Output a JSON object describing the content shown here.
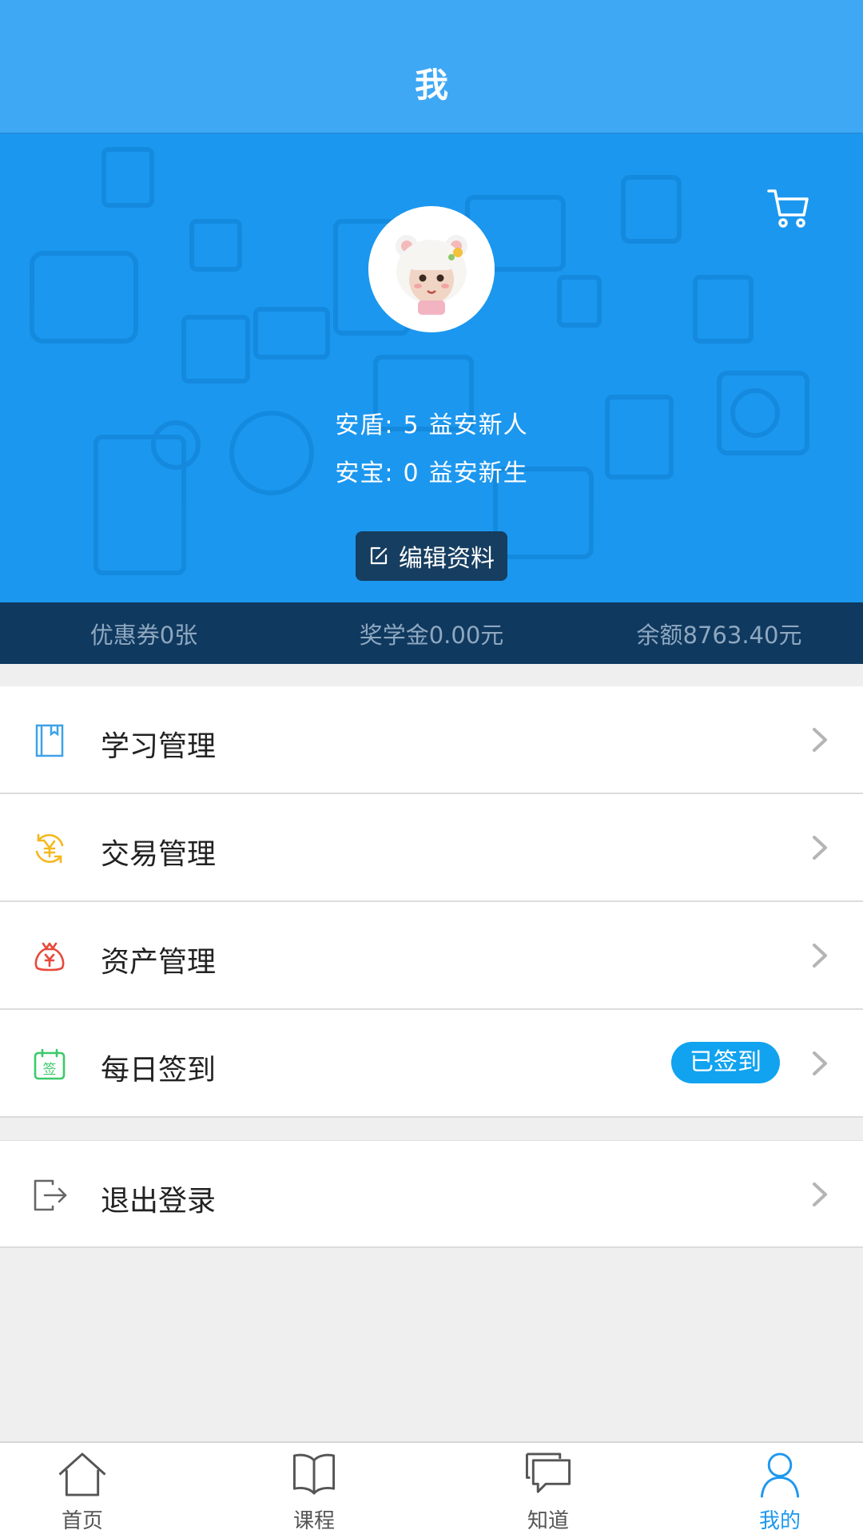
{
  "header": {
    "title": "我"
  },
  "profile": {
    "line1": {
      "label": "安盾:",
      "value": "5",
      "rank": "益安新人"
    },
    "line2": {
      "label": "安宝:",
      "value": "0",
      "rank": "益安新生"
    },
    "edit_label": "编辑资料"
  },
  "wallet": {
    "coupons": "优惠券0张",
    "scholarship": "奖学金0.00元",
    "balance": "余额8763.40元"
  },
  "menu": [
    {
      "label": "学习管理",
      "icon": "book-icon",
      "color": "#3da2e8"
    },
    {
      "label": "交易管理",
      "icon": "yuan-exchange-icon",
      "color": "#f3b81f"
    },
    {
      "label": "资产管理",
      "icon": "money-bag-icon",
      "color": "#e8493b"
    },
    {
      "label": "每日签到",
      "icon": "calendar-sign-icon",
      "color": "#3cc96a",
      "badge": "已签到"
    }
  ],
  "logout": {
    "label": "退出登录",
    "icon": "logout-icon"
  },
  "tabs": [
    {
      "label": "首页",
      "icon": "home-icon"
    },
    {
      "label": "课程",
      "icon": "book-open-icon"
    },
    {
      "label": "知道",
      "icon": "chat-icon"
    },
    {
      "label": "我的",
      "icon": "user-icon",
      "active": true
    }
  ],
  "colors": {
    "header_bg": "#3ea8f5",
    "hero_bg": "#1b97ef",
    "wallet_bg": "#10395f",
    "accent": "#1d98ee",
    "badge_bg": "#11a3f0"
  }
}
